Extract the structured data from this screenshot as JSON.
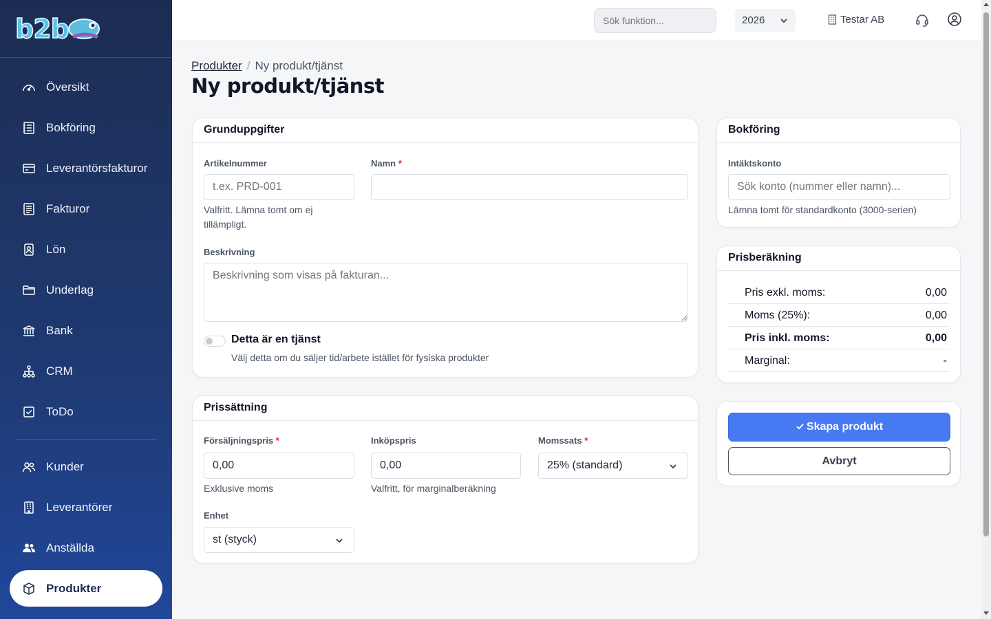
{
  "brand": {
    "logo_text": "b2b"
  },
  "sidebar": {
    "items": [
      {
        "label": "Översikt",
        "icon": "gauge-icon"
      },
      {
        "label": "Bokföring",
        "icon": "ledger-icon"
      },
      {
        "label": "Leverantörsfakturor",
        "icon": "card-icon"
      },
      {
        "label": "Fakturor",
        "icon": "invoice-icon"
      },
      {
        "label": "Lön",
        "icon": "id-badge-icon"
      },
      {
        "label": "Underlag",
        "icon": "folder-icon"
      },
      {
        "label": "Bank",
        "icon": "bank-icon"
      },
      {
        "label": "CRM",
        "icon": "org-chart-icon"
      },
      {
        "label": "ToDo",
        "icon": "checkbox-icon"
      }
    ],
    "items2": [
      {
        "label": "Kunder",
        "icon": "users-icon"
      },
      {
        "label": "Leverantörer",
        "icon": "building-icon"
      },
      {
        "label": "Anställda",
        "icon": "people-icon"
      }
    ],
    "active": {
      "label": "Produkter",
      "icon": "box-icon"
    }
  },
  "topbar": {
    "search_placeholder": "Sök funktion...",
    "year": "2026",
    "company": "Testar AB"
  },
  "breadcrumb": {
    "parent": "Produkter",
    "current": "Ny produkt/tjänst"
  },
  "page_title": "Ny produkt/tjänst",
  "basic": {
    "title": "Grunduppgifter",
    "article_label": "Artikelnummer",
    "article_placeholder": "t.ex. PRD-001",
    "article_help": "Valfritt. Lämna tomt om ej tillämpligt.",
    "name_label": "Namn",
    "name_value": "",
    "required_mark": "*",
    "desc_label": "Beskrivning",
    "desc_placeholder": "Beskrivning som visas på fakturan...",
    "service_label": "Detta är en tjänst",
    "service_help": "Välj detta om du säljer tid/arbete istället för fysiska produkter"
  },
  "pricing": {
    "title": "Prissättning",
    "sale_label": "Försäljningspris",
    "sale_value": "0,00",
    "sale_help": "Exklusive moms",
    "purchase_label": "Inköpspris",
    "purchase_value": "0,00",
    "purchase_help": "Valfritt, för marginalberäkning",
    "vat_label": "Momssats",
    "vat_value": "25% (standard)",
    "unit_label": "Enhet",
    "unit_value": "st (styck)"
  },
  "accounting": {
    "title": "Bokföring",
    "account_label": "Intäktskonto",
    "account_placeholder": "Sök konto (nummer eller namn)...",
    "account_help": "Lämna tomt för standardkonto (3000-serien)"
  },
  "calc": {
    "title": "Prisberäkning",
    "rows": [
      {
        "label": "Pris exkl. moms:",
        "value": "0,00"
      },
      {
        "label": "Moms (25%):",
        "value": "0,00"
      },
      {
        "label": "Pris inkl. moms:",
        "value": "0,00"
      },
      {
        "label": "Marginal:",
        "value": "-"
      }
    ]
  },
  "actions": {
    "create": "Skapa produkt",
    "cancel": "Avbryt"
  },
  "colors": {
    "sidebar": "#1f3a73",
    "primary": "#4679f2",
    "required": "#dc2626"
  }
}
